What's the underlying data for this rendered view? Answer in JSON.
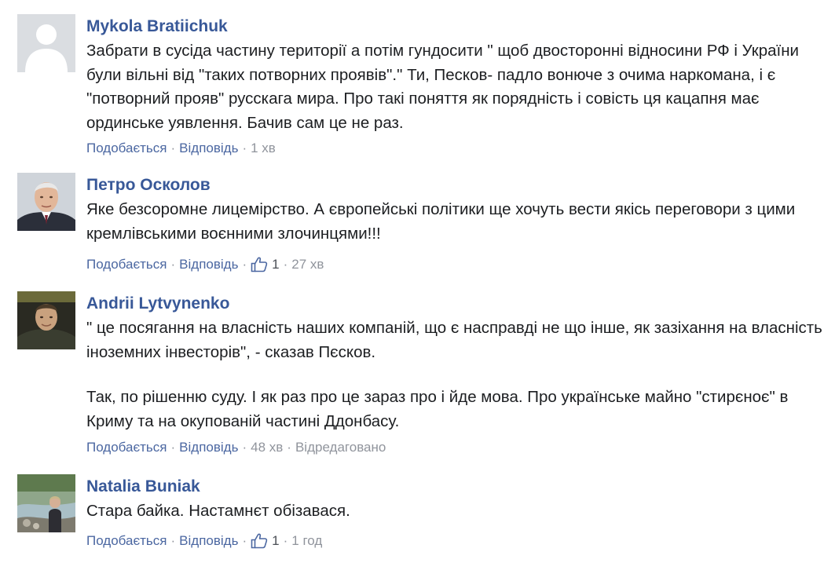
{
  "comments": [
    {
      "author": "Mykola Bratiichuk",
      "avatar_icon": "default-profile-silhouette-icon",
      "paragraphs": [
        "Забрати в сусіда частину території а потім гундосити \" щоб двосторонні відносини РФ і України були вільні від \"таких потворних проявів\".\" Ти, Песков- падло вонюче з очима наркомана, і є \"потворний прояв\" русскага мира. Про такі поняття як порядність і совість ця кацапня має ординське уявлення. Бачив сам це не раз."
      ],
      "like_label": "Подобається",
      "reply_label": "Відповідь",
      "likes": "",
      "time": "1 хв",
      "edited": ""
    },
    {
      "author": "Петро Осколов",
      "avatar_icon": "elderly-man-photo",
      "paragraphs": [
        "Яке безсоромне лицемірство. А європейські політики ще хочуть вести якісь переговори з цими кремлівськими воєнними злочинцями!!!"
      ],
      "like_label": "Подобається",
      "reply_label": "Відповідь",
      "likes": "1",
      "time": "27 хв",
      "edited": ""
    },
    {
      "author": "Andrii Lytvynenko",
      "avatar_icon": "man-photo-dark-background",
      "paragraphs": [
        "\" це посягання на власність наших компаній, що є насправді не що інше, як зазіхання на власність іноземних інвесторів\", - сказав Пєсков.",
        "Так, по рішенню суду. І як раз про це зараз про і йде мова. Про українське майно \"стирєноє\" в Криму та на окупованій частині Ддонбасу."
      ],
      "like_label": "Подобається",
      "reply_label": "Відповідь",
      "likes": "",
      "time": "48 хв",
      "edited": "Відредаговано"
    },
    {
      "author": "Natalia Buniak",
      "avatar_icon": "woman-by-river-photo",
      "paragraphs": [
        "Стара байка. Настамнєт обізавася."
      ],
      "like_label": "Подобається",
      "reply_label": "Відповідь",
      "likes": "1",
      "time": "1 год",
      "edited": ""
    }
  ],
  "colors": {
    "author": "#385898",
    "link": "#4b67a1",
    "text": "#1c1e21",
    "meta": "#90949c"
  }
}
